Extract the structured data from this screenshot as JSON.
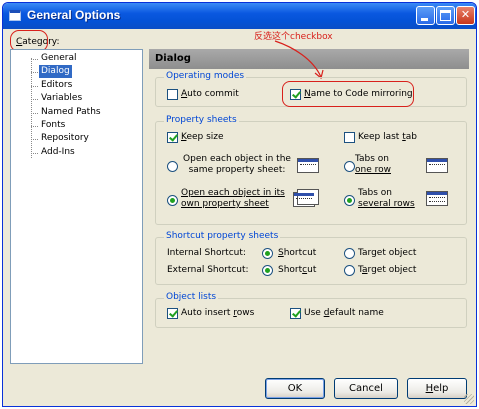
{
  "window": {
    "title": "General Options"
  },
  "category": {
    "label_prefix": "",
    "label_underlined": "C",
    "label_rest": "ategory:",
    "items": [
      "General",
      "Dialog",
      "Editors",
      "Variables",
      "Named Paths",
      "Fonts",
      "Repository",
      "Add-Ins"
    ],
    "selected": "Dialog"
  },
  "header": {
    "title": "Dialog"
  },
  "annotation": {
    "text": "反选这个checkbox",
    "color": "#d8211c"
  },
  "operating_modes": {
    "title": "Operating modes",
    "auto_commit": {
      "pre": "",
      "u": "A",
      "post": "uto commit",
      "checked": false
    },
    "name_to_code": {
      "pre": "",
      "u": "N",
      "post": "ame to Code mirroring",
      "checked": true
    }
  },
  "property_sheets": {
    "title": "Property sheets",
    "keep_size": {
      "pre": "",
      "u": "K",
      "post": "eep size",
      "checked": true
    },
    "keep_last_tab": {
      "pre": "Keep last ",
      "u": "t",
      "post": "ab",
      "checked": false
    },
    "open_same": {
      "line1": "Open each object in the",
      "line2": "same property sheet:",
      "checked": false
    },
    "tabs_one_row": {
      "line1": "Tabs on",
      "line2": "one row",
      "checked": false
    },
    "open_own": {
      "line1": "Open each object in its",
      "line2": "own property sheet",
      "checked": true
    },
    "tabs_several_rows": {
      "line1": "Tabs on",
      "line2": "several rows",
      "checked": true
    }
  },
  "shortcut_sheets": {
    "title": "Shortcut property sheets",
    "internal_label": "Internal Shortcut:",
    "external_label": "External Shortcut:",
    "shortcut": "Shortcut",
    "target_object": "Target object",
    "internal_selected": "Shortcut",
    "external_selected": "Shortcut"
  },
  "object_lists": {
    "title": "Object lists",
    "auto_insert_rows": {
      "pre": "Auto insert ",
      "u": "r",
      "post": "ows",
      "checked": true
    },
    "use_default_name": {
      "pre": "Use ",
      "u": "d",
      "post": "efault name",
      "checked": true
    }
  },
  "buttons": {
    "ok": "OK",
    "cancel": "Cancel",
    "help_u": "H",
    "help_rest": "elp"
  },
  "colors": {
    "titlebar": "#0a58e0",
    "dialog_bg": "#ece9d8",
    "selection": "#316ac5",
    "group_title": "#0046d5"
  },
  "icons": [
    "app-window-icon",
    "minimize-icon",
    "maximize-icon",
    "close-icon",
    "single-row-tabs-icon",
    "several-rows-tabs-icon",
    "same-sheet-icon",
    "own-sheet-icon"
  ]
}
